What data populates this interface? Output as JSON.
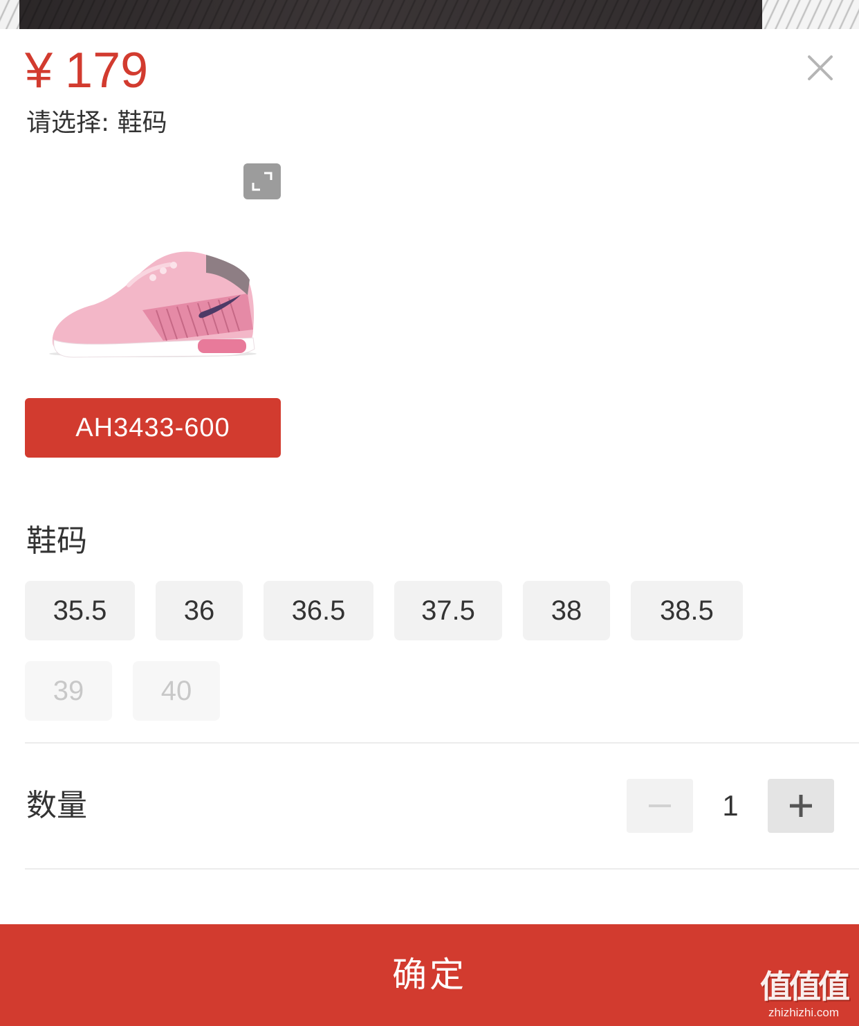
{
  "product": {
    "currency": "¥",
    "price": "179",
    "selection_prompt": "请选择: 鞋码",
    "variant_code": "AH3433-600"
  },
  "size_section": {
    "title": "鞋码",
    "sizes": [
      {
        "label": "35.5",
        "available": true
      },
      {
        "label": "36",
        "available": true
      },
      {
        "label": "36.5",
        "available": true
      },
      {
        "label": "37.5",
        "available": true
      },
      {
        "label": "38",
        "available": true
      },
      {
        "label": "38.5",
        "available": true
      },
      {
        "label": "39",
        "available": false
      },
      {
        "label": "40",
        "available": false
      }
    ]
  },
  "quantity_section": {
    "title": "数量",
    "value": "1"
  },
  "footer": {
    "confirm_label": "确定"
  },
  "watermark": {
    "main": "值值值",
    "sub": "zhizhizhi.com"
  },
  "icons": {
    "close": "close-icon",
    "expand": "expand-icon",
    "minus": "minus-icon",
    "plus": "plus-icon"
  },
  "colors": {
    "accent": "#d23b2f",
    "chip_bg": "#f2f2f2",
    "disabled_text": "#c8c8c8"
  }
}
